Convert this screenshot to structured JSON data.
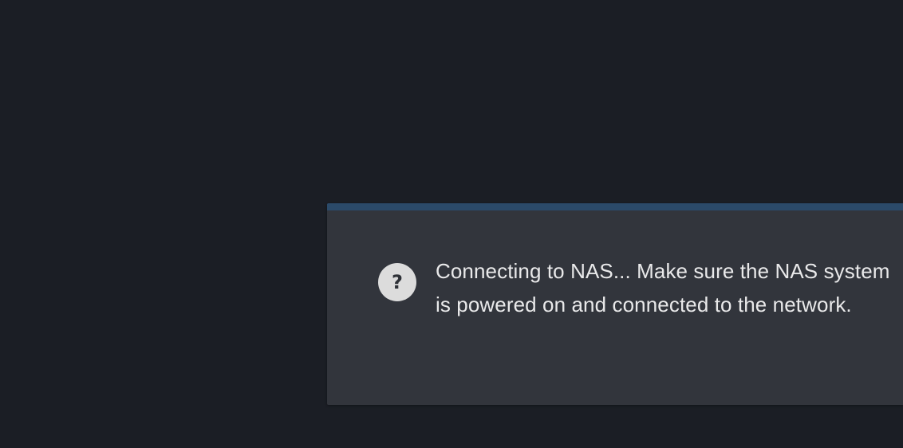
{
  "dialog": {
    "icon": "question-icon",
    "icon_glyph": "?",
    "message": "Connecting to NAS... Make sure the NAS system is powered on and connected to the network."
  },
  "colors": {
    "background": "#1b1e25",
    "dialog_background": "#32353c",
    "accent_bar": "#2b4a69",
    "icon_background": "#dcdcdc",
    "text": "#e9e9ea"
  }
}
